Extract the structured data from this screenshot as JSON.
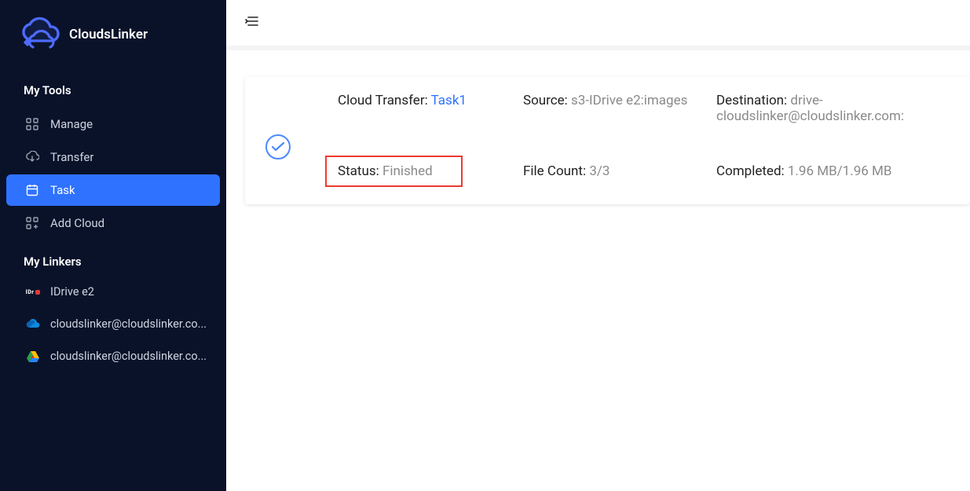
{
  "app": {
    "name": "CloudsLinker"
  },
  "sidebar": {
    "section1_title": "My Tools",
    "items": [
      {
        "label": "Manage"
      },
      {
        "label": "Transfer"
      },
      {
        "label": "Task"
      },
      {
        "label": "Add Cloud"
      }
    ],
    "section2_title": "My Linkers",
    "linkers": [
      {
        "label": "IDrive e2"
      },
      {
        "label": "cloudslinker@cloudslinker.co..."
      },
      {
        "label": "cloudslinker@cloudslinker.co..."
      }
    ]
  },
  "task": {
    "transfer_label": "Cloud Transfer: ",
    "transfer_name": "Task1",
    "source_label": "Source: ",
    "source_value": "s3-IDrive e2:images",
    "dest_label": "Destination: ",
    "dest_value": "drive-cloudslinker@cloudslinker.com:",
    "status_label": "Status: ",
    "status_value": "Finished",
    "filecount_label": "File Count: ",
    "filecount_value": "3/3",
    "completed_label": "Completed: ",
    "completed_value": "1.96 MB/1.96 MB"
  }
}
